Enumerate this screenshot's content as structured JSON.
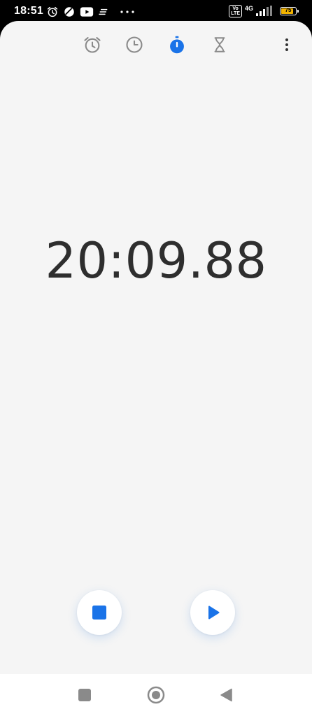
{
  "status_bar": {
    "time": "18:51",
    "left_icons": [
      "alarm-icon",
      "data-saver-icon",
      "youtube-icon",
      "notes-icon",
      "more-notifications-icon"
    ],
    "volte": "Vo\nLTE",
    "network": "4G",
    "battery_level": "75"
  },
  "tabs": [
    {
      "name": "alarm",
      "icon": "alarm-clock-icon",
      "active": false
    },
    {
      "name": "clock",
      "icon": "clock-icon",
      "active": false
    },
    {
      "name": "stopwatch",
      "icon": "stopwatch-icon",
      "active": true
    },
    {
      "name": "timer",
      "icon": "hourglass-icon",
      "active": false
    }
  ],
  "stopwatch": {
    "elapsed": "20:09.88",
    "state": "paused"
  },
  "controls": {
    "stop_icon": "stop-icon",
    "resume_icon": "play-icon"
  },
  "navigation": {
    "recents_icon": "square-icon",
    "home_icon": "circle-icon",
    "back_icon": "triangle-back-icon"
  },
  "colors": {
    "accent": "#1a73e8",
    "icon_inactive": "#8a8a8a",
    "background": "#f5f5f5",
    "text": "#2e2e2e"
  }
}
